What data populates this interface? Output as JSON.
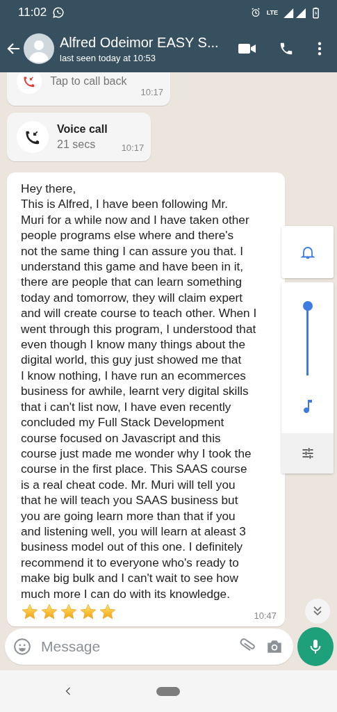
{
  "status_bar": {
    "time": "11:02",
    "network": "LTE"
  },
  "header": {
    "name": "Alfred Odeimor EASY S...",
    "status": "last seen today at 10:53"
  },
  "messages": [
    {
      "kind": "call",
      "detail": "Tap to call back",
      "time": "10:17",
      "missed": true
    },
    {
      "kind": "call",
      "title": "Voice call",
      "detail": "21 secs",
      "time": "10:17",
      "missed": false
    },
    {
      "kind": "text",
      "text": "Hey there,\nThis is Alfred, I have been following Mr.\nMuri for a while now and I have taken other\npeople programs else where and there's\nnot the same thing I can assure you that. I\nunderstand this game and have been in it,\nthere are people that can learn something\ntoday and tomorrow, they will claim expert\nand will create course to teach other. When I\nwent through this program, I understood that\neven though I know many things about the\ndigital world, this guy just showed me that\nI know nothing, I have run an ecommerces\nbusiness for awhile, learnt very digital skills\nthat i can't list now, I have even recently\nconcluded my Full Stack Development\ncourse focused on Javascript and this\ncourse just made me wonder why I took the\ncourse in the first place. This SAAS course\nis a real cheat code. Mr. Muri will tell you\nthat he will teach you SAAS business but\nyou are going learn more than that if you\nand listening well, you will learn at aleast 3\nbusiness model out of this one. I definitely\nrecommend it to everyone who's ready to\nmake big bulk and I can't wait to see how\nmuch more I can do with its knowledge.",
      "stars": 5,
      "time": "10:47"
    }
  ],
  "volume_panel": {
    "level": 1.0
  },
  "composer": {
    "placeholder": "Message"
  }
}
